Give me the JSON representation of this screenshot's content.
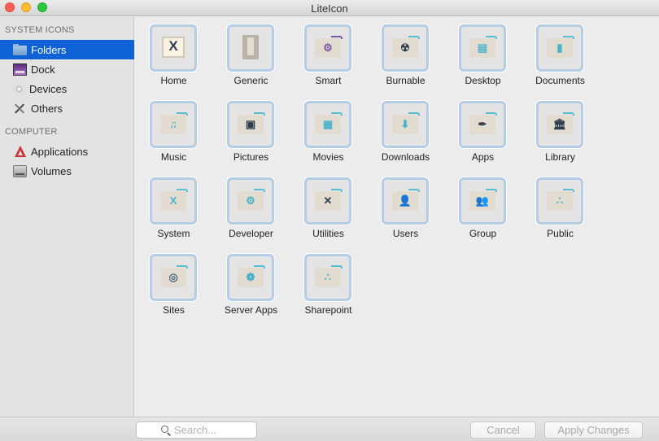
{
  "window": {
    "title": "LiteIcon"
  },
  "sidebar": {
    "sections": [
      {
        "heading": "SYSTEM ICONS",
        "items": [
          {
            "label": "Folders",
            "icon": "folder-icon",
            "selected": true
          },
          {
            "label": "Dock",
            "icon": "dock-icon",
            "selected": false
          },
          {
            "label": "Devices",
            "icon": "disc-icon",
            "selected": false
          },
          {
            "label": "Others",
            "icon": "tools-icon",
            "selected": false
          }
        ]
      },
      {
        "heading": "COMPUTER",
        "items": [
          {
            "label": "Applications",
            "icon": "applications-icon",
            "selected": false
          },
          {
            "label": "Volumes",
            "icon": "drive-icon",
            "selected": false
          }
        ]
      }
    ]
  },
  "grid": {
    "items": [
      {
        "label": "Home",
        "icon": "home-x",
        "glyph": "X"
      },
      {
        "label": "Generic",
        "icon": "generic-folder",
        "glyph": ""
      },
      {
        "label": "Smart",
        "icon": "gear",
        "glyph": "⚙",
        "color": "#7a5aa6"
      },
      {
        "label": "Burnable",
        "icon": "radiation",
        "glyph": "☢",
        "color": "#2e3e4e"
      },
      {
        "label": "Desktop",
        "icon": "desktop-window",
        "glyph": "▤",
        "color": "#4bb2cb"
      },
      {
        "label": "Documents",
        "icon": "document",
        "glyph": "▮",
        "color": "#4bb2cb"
      },
      {
        "label": "Music",
        "icon": "music-note",
        "glyph": "♫",
        "color": "#4bb2cb"
      },
      {
        "label": "Pictures",
        "icon": "picture",
        "glyph": "▣",
        "color": "#2e3e4e"
      },
      {
        "label": "Movies",
        "icon": "clapperboard",
        "glyph": "▦",
        "color": "#4bb2cb"
      },
      {
        "label": "Downloads",
        "icon": "down-arrow",
        "glyph": "⬇",
        "color": "#4bb2cb"
      },
      {
        "label": "Apps",
        "icon": "pen-nib",
        "glyph": "✒",
        "color": "#2e3e4e"
      },
      {
        "label": "Library",
        "icon": "bank",
        "glyph": "🏛",
        "color": "#2e3e4e"
      },
      {
        "label": "System",
        "icon": "system-x",
        "glyph": "X",
        "color": "#4bb2cb"
      },
      {
        "label": "Developer",
        "icon": "gear",
        "glyph": "⚙",
        "color": "#4bb2cb"
      },
      {
        "label": "Utilities",
        "icon": "wrench-screwdriver",
        "glyph": "✕",
        "color": "#2e3e4e"
      },
      {
        "label": "Users",
        "icon": "user",
        "glyph": "👤",
        "color": "#2e3e4e"
      },
      {
        "label": "Group",
        "icon": "group",
        "glyph": "👥",
        "color": "#2e3e4e"
      },
      {
        "label": "Public",
        "icon": "share-dots",
        "glyph": "∴",
        "color": "#4bb2cb"
      },
      {
        "label": "Sites",
        "icon": "globe",
        "glyph": "◎",
        "color": "#4a6a80"
      },
      {
        "label": "Server Apps",
        "icon": "globe-network",
        "glyph": "❁",
        "color": "#4bb2cb"
      },
      {
        "label": "Sharepoint",
        "icon": "share-dots",
        "glyph": "∴",
        "color": "#4bb2cb"
      }
    ]
  },
  "footer": {
    "search_placeholder": "Search...",
    "search_value": "",
    "cancel_label": "Cancel",
    "apply_label": "Apply Changes"
  }
}
